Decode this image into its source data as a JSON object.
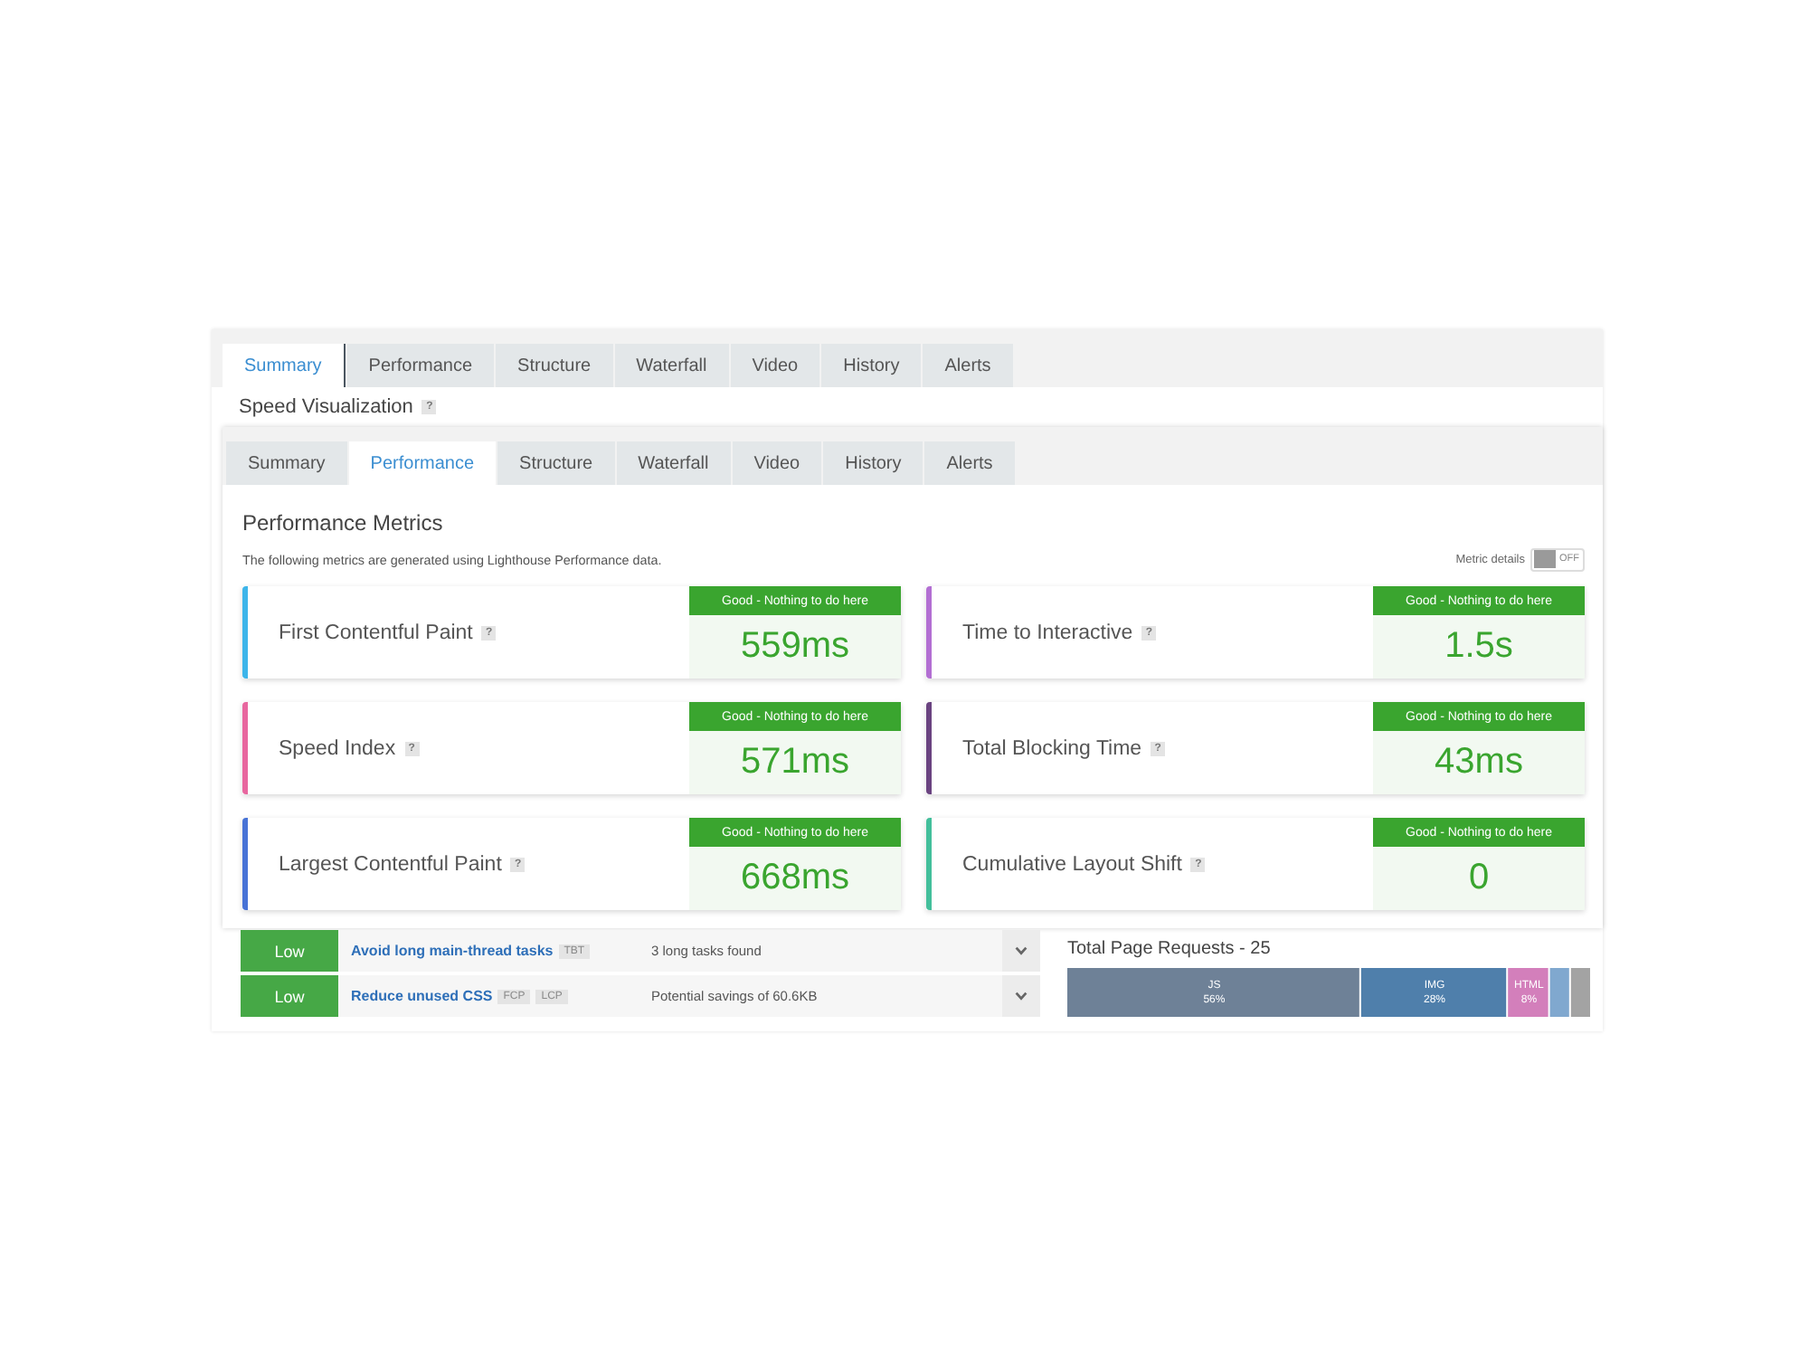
{
  "back_tabs": [
    {
      "label": "Summary",
      "selected": true
    },
    {
      "label": "Performance",
      "selected": false
    },
    {
      "label": "Structure",
      "selected": false
    },
    {
      "label": "Waterfall",
      "selected": false
    },
    {
      "label": "Video",
      "selected": false
    },
    {
      "label": "History",
      "selected": false
    },
    {
      "label": "Alerts",
      "selected": false
    }
  ],
  "section_heading": {
    "title": "Speed Visualization",
    "help": "?"
  },
  "metrics_panel": {
    "tabs": [
      {
        "label": "Summary",
        "selected": false
      },
      {
        "label": "Performance",
        "selected": true
      },
      {
        "label": "Structure",
        "selected": false
      },
      {
        "label": "Waterfall",
        "selected": false
      },
      {
        "label": "Video",
        "selected": false
      },
      {
        "label": "History",
        "selected": false
      },
      {
        "label": "Alerts",
        "selected": false
      }
    ],
    "title": "Performance Metrics",
    "subtitle": "The following metrics are generated using Lighthouse Performance data.",
    "metric_details": {
      "label": "Metric details",
      "state_text": "OFF",
      "on": false
    },
    "metrics": [
      {
        "name": "First Contentful Paint",
        "help": "?",
        "status": "Good - Nothing to do here",
        "value": "559ms",
        "color": "#3db5ea"
      },
      {
        "name": "Time to Interactive",
        "help": "?",
        "status": "Good - Nothing to do here",
        "value": "1.5s",
        "color": "#b36fd3"
      },
      {
        "name": "Speed Index",
        "help": "?",
        "status": "Good - Nothing to do here",
        "value": "571ms",
        "color": "#e8679f"
      },
      {
        "name": "Total Blocking Time",
        "help": "?",
        "status": "Good - Nothing to do here",
        "value": "43ms",
        "color": "#6a4380"
      },
      {
        "name": "Largest Contentful Paint",
        "help": "?",
        "status": "Good - Nothing to do here",
        "value": "668ms",
        "color": "#4873d6"
      },
      {
        "name": "Cumulative Layout Shift",
        "help": "?",
        "status": "Good - Nothing to do here",
        "value": "0",
        "color": "#43bf9b"
      }
    ]
  },
  "audits": [
    {
      "severity": "Low",
      "title": "Avoid long main-thread tasks",
      "tags": [
        "TBT"
      ],
      "detail": "3 long tasks found"
    },
    {
      "severity": "Low",
      "title": "Reduce unused CSS",
      "tags": [
        "FCP",
        "LCP"
      ],
      "detail": "Potential savings of 60.6KB"
    }
  ],
  "requests_chart": {
    "chart_data": {
      "type": "bar",
      "title": "Total Page Requests - 25",
      "orientation": "horizontal",
      "stacked": true,
      "series": [
        {
          "name": "JS",
          "color": "#6e8197",
          "values": [
            56
          ],
          "value_labels": [
            "56%"
          ]
        },
        {
          "name": "IMG",
          "color": "#4f7fab",
          "values": [
            28
          ],
          "value_labels": [
            "28%"
          ]
        },
        {
          "name": "HTML",
          "color": "#d37fbb",
          "values": [
            8
          ],
          "value_labels": [
            "8%"
          ]
        },
        {
          "color": "#80a8cf",
          "values": [
            4
          ],
          "value_labels": [
            null
          ]
        },
        {
          "color": "#a3a3a3",
          "values": [
            4
          ],
          "value_labels": [
            null
          ]
        }
      ]
    }
  }
}
